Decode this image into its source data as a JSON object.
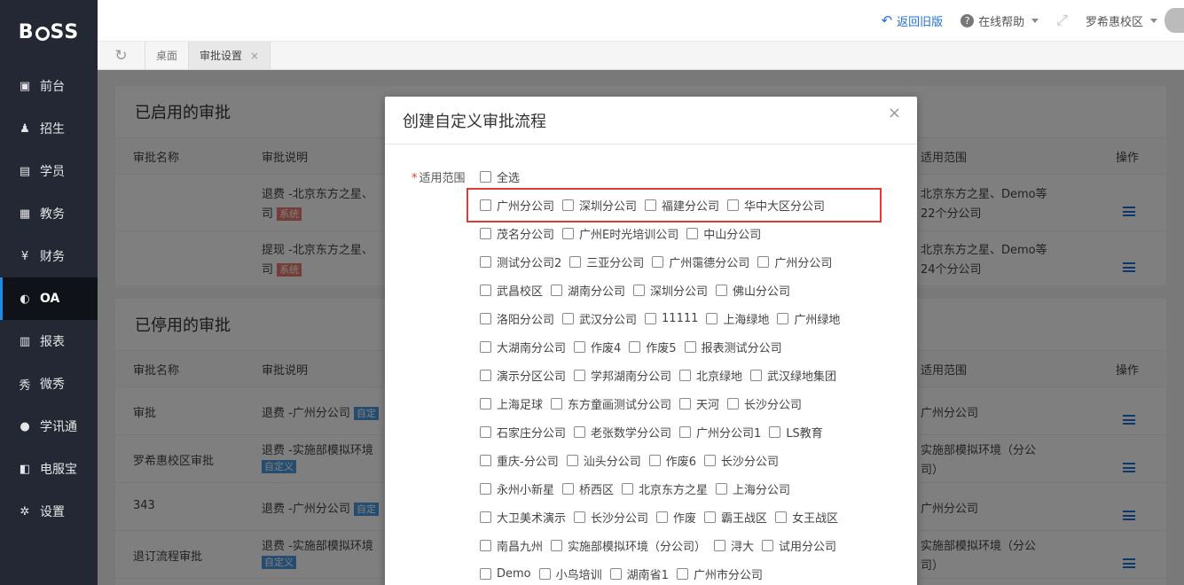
{
  "app": {
    "logo": "BOSS"
  },
  "sidebar": {
    "items": [
      {
        "label": "前台",
        "icon": "calendar-icon"
      },
      {
        "label": "招生",
        "icon": "user-add-icon"
      },
      {
        "label": "学员",
        "icon": "id-card-icon"
      },
      {
        "label": "教务",
        "icon": "book-icon"
      },
      {
        "label": "财务",
        "icon": "yen-icon"
      },
      {
        "label": "OA",
        "icon": "chat-icon",
        "active": true
      },
      {
        "label": "报表",
        "icon": "bar-chart-icon"
      },
      {
        "label": "微秀",
        "icon": "xiu-icon"
      },
      {
        "label": "学讯通",
        "icon": "location-icon"
      },
      {
        "label": "电服宝",
        "icon": "phone-icon"
      },
      {
        "label": "设置",
        "icon": "gear-icon"
      }
    ]
  },
  "topbar": {
    "back": "返回旧版",
    "help": "在线帮助",
    "campus": "罗希惠校区"
  },
  "tabs": [
    {
      "label": "桌面"
    },
    {
      "label": "审批设置",
      "close": "×"
    }
  ],
  "enabled_section": {
    "title": "已启用的审批",
    "columns": {
      "name": "审批名称",
      "desc": "审批说明",
      "scope": "适用范围",
      "op": "操作"
    },
    "rows": [
      {
        "name": "",
        "desc1": "退费 -北京东方之星、",
        "desc2": "司",
        "badge": "系统",
        "scope1": "北京东方之星、Demo等",
        "scope2": "22个分公司"
      },
      {
        "name": "",
        "desc1": "提现 -北京东方之星、",
        "desc2": "司",
        "badge": "系统",
        "scope1": "北京东方之星、Demo等",
        "scope2": "24个分公司"
      }
    ]
  },
  "disabled_section": {
    "title": "已停用的审批",
    "columns": {
      "name": "审批名称",
      "desc": "审批说明",
      "scope": "适用范围",
      "op": "操作"
    },
    "rows": [
      {
        "name": "审批",
        "desc1": "退费 -广州分公司",
        "badge": "自定",
        "scope1": "广州分公司",
        "scope2": ""
      },
      {
        "name": "罗希惠校区审批",
        "desc1": "退费 -实施部模拟环境",
        "badge": "自定义",
        "scope1": "实施部模拟环境（分公",
        "scope2": "司）"
      },
      {
        "name": "343",
        "desc1": "退费 -广州分公司",
        "badge": "自定",
        "scope1": "广州分公司",
        "scope2": ""
      },
      {
        "name": "退订流程审批",
        "desc1": "退费 -实施部模拟环境",
        "badge": "自定义",
        "scope1": "实施部模拟环境（分公",
        "scope2": "司）"
      }
    ]
  },
  "modal": {
    "title": "创建自定义审批流程",
    "close": "×",
    "scope_label": "适用范围",
    "required_mark": "*",
    "select_all": "全选",
    "branch_rows": [
      [
        "广州分公司",
        "深圳分公司",
        "福建分公司",
        "华中大区分公司"
      ],
      [
        "茂名分公司",
        "广州E时光培训公司",
        "中山分公司"
      ],
      [
        "测试分公司2",
        "三亚分公司",
        "广州霭德分公司",
        "广州分公司"
      ],
      [
        "武昌校区",
        "湖南分公司",
        "深圳分公司",
        "佛山分公司"
      ],
      [
        "洛阳分公司",
        "武汉分公司",
        "11111",
        "上海绿地",
        "广州绿地"
      ],
      [
        "大湖南分公司",
        "作废4",
        "作废5",
        "报表测试分公司"
      ],
      [
        "演示分区公司",
        "学邦湖南分公司",
        "北京绿地",
        "武汉绿地集团"
      ],
      [
        "上海足球",
        "东方童画测试分公司",
        "天河",
        "长沙分公司"
      ],
      [
        "石家庄分公司",
        "老张数学分公司",
        "广州分公司1",
        "LS教育"
      ],
      [
        "重庆-分公司",
        "汕头分公司",
        "作废6",
        "长沙分公司"
      ],
      [
        "永州小新星",
        "桥西区",
        "北京东方之星",
        "上海分公司"
      ],
      [
        "大卫美术演示",
        "长沙分公司",
        "作废",
        "霸王战区",
        "女王战区"
      ],
      [
        "南昌九州",
        "实施部模拟环境（分公司）",
        "浔大",
        "试用分公司"
      ],
      [
        "Demo",
        "小鸟培训",
        "湖南省1",
        "广州市分公司"
      ]
    ]
  }
}
